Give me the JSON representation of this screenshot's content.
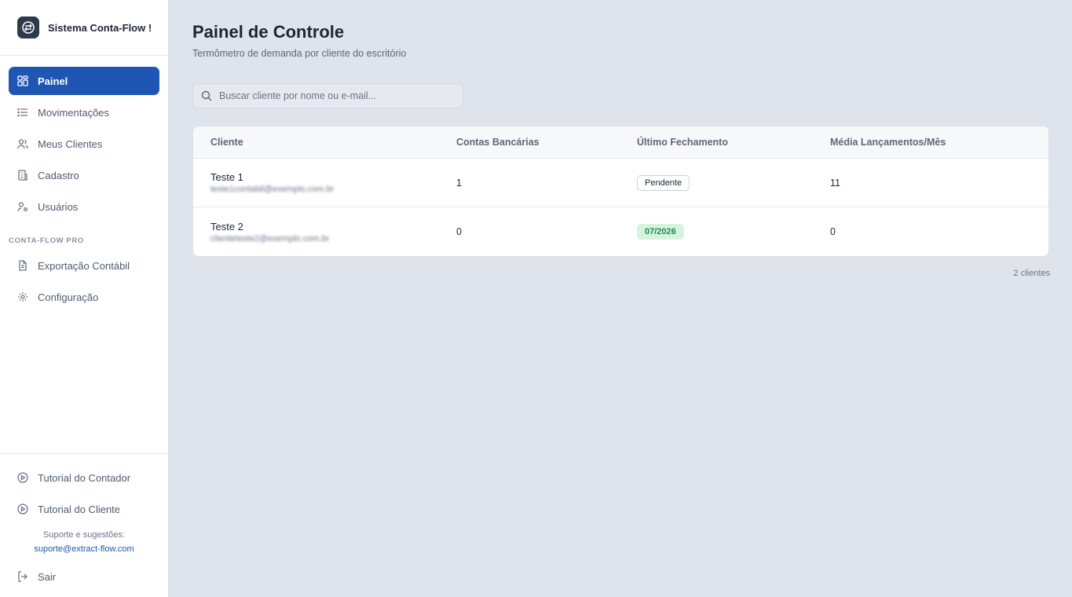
{
  "brand": {
    "name": "Sistema Conta-Flow !"
  },
  "nav": {
    "items": [
      {
        "label": "Painel",
        "icon": "dashboard-icon",
        "active": true
      },
      {
        "label": "Movimentações",
        "icon": "list-icon"
      },
      {
        "label": "Meus Clientes",
        "icon": "users-icon"
      },
      {
        "label": "Cadastro",
        "icon": "building-icon"
      },
      {
        "label": "Usuários",
        "icon": "user-key-icon"
      }
    ],
    "section_label": "CONTA-FLOW PRO",
    "pro_items": [
      {
        "label": "Exportação Contábil",
        "icon": "file-icon"
      },
      {
        "label": "Configuração",
        "icon": "gear-icon"
      }
    ]
  },
  "bottom": {
    "tutorials": [
      {
        "label": "Tutorial do Contador",
        "icon": "play-circle-icon"
      },
      {
        "label": "Tutorial do Cliente",
        "icon": "play-circle-icon"
      }
    ],
    "support_label": "Suporte e sugestões:",
    "support_email": "suporte@extract-flow.com",
    "logout_label": "Sair"
  },
  "main": {
    "title": "Painel de Controle",
    "subtitle": "Termômetro de demanda por cliente do escritório",
    "search_placeholder": "Buscar cliente por nome ou e-mail...",
    "table": {
      "headers": [
        "Cliente",
        "Contas Bancárias",
        "Último Fechamento",
        "Média Lançamentos/Mês"
      ],
      "rows": [
        {
          "name": "Teste 1",
          "email": "teste1contabil@exemplo.com.br",
          "accounts": "1",
          "closing": "Pendente",
          "closing_status": "pending",
          "avg": "11"
        },
        {
          "name": "Teste 2",
          "email": "clienteteste2@exemplo.com.br",
          "accounts": "0",
          "closing": "07/2026",
          "closing_status": "done",
          "avg": "0"
        }
      ]
    },
    "count_label": "2 clientes"
  },
  "colors": {
    "accent": "#1f56b3",
    "success": "#1f8a4c",
    "success_bg": "#d6f3e0",
    "background": "#dfe3eb"
  }
}
